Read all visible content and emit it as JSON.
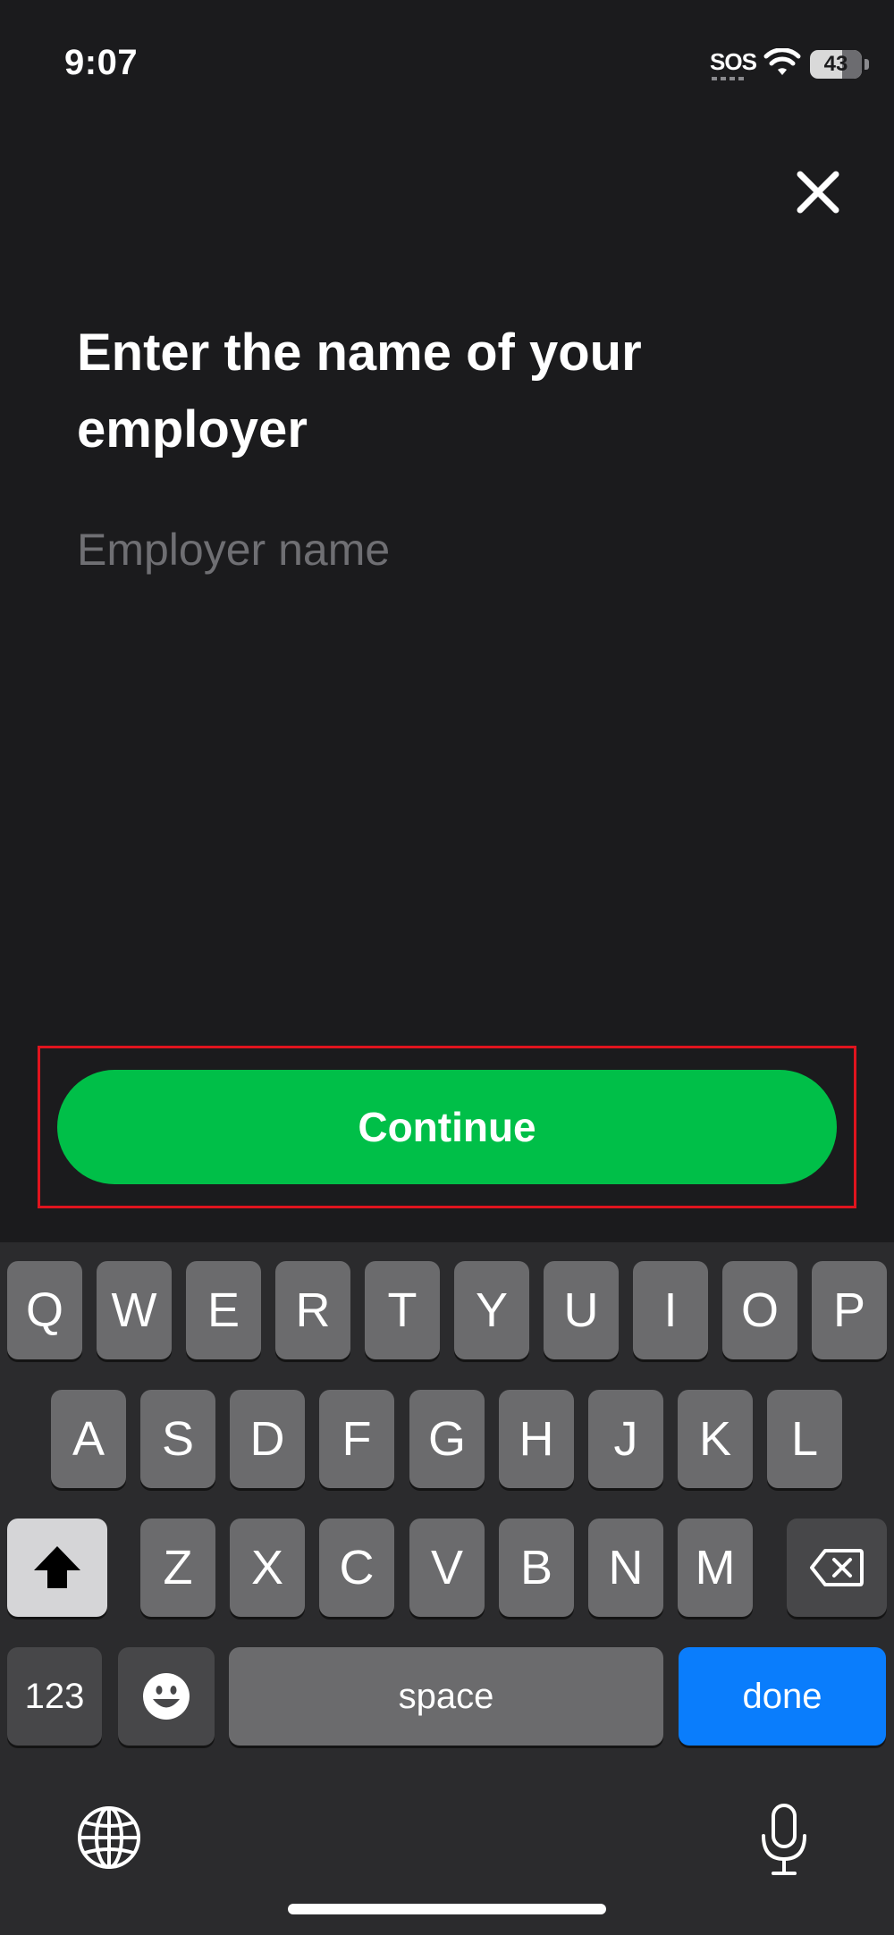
{
  "status_bar": {
    "time": "9:07",
    "sos": "SOS",
    "battery": "43",
    "icons": [
      "wifi-icon",
      "battery-icon"
    ]
  },
  "close": {
    "icon": "close-icon"
  },
  "title": "Enter the name of your employer",
  "employer_input": {
    "value": "",
    "placeholder": "Employer name"
  },
  "continue_label": "Continue",
  "colors": {
    "background": "#1b1b1d",
    "accent": "#00bf48",
    "highlight": "#e0141e",
    "done_key": "#0a7dfc"
  },
  "keyboard": {
    "row1": [
      "Q",
      "W",
      "E",
      "R",
      "T",
      "Y",
      "U",
      "I",
      "O",
      "P"
    ],
    "row2": [
      "A",
      "S",
      "D",
      "F",
      "G",
      "H",
      "J",
      "K",
      "L"
    ],
    "row3": [
      "Z",
      "X",
      "C",
      "V",
      "B",
      "N",
      "M"
    ],
    "numbers_label": "123",
    "space_label": "space",
    "done_label": "done",
    "icons": [
      "shift-icon",
      "backspace-icon",
      "emoji-icon",
      "globe-icon",
      "microphone-icon"
    ]
  }
}
